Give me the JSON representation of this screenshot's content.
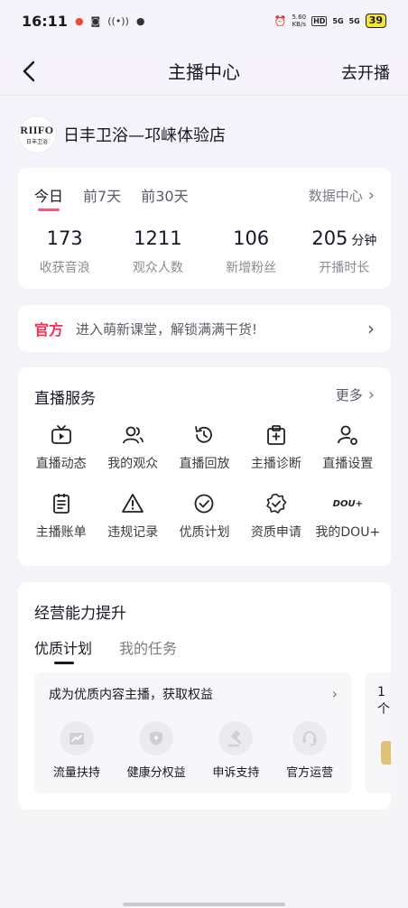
{
  "status_bar": {
    "time": "16:11",
    "net_speed_value": "5.60",
    "net_speed_unit": "KB/s",
    "hd_tag": "HD",
    "sig1": "5G",
    "sig2": "5G",
    "battery": "39"
  },
  "nav": {
    "title": "主播中心",
    "action": "去开播"
  },
  "shop": {
    "logo_line1": "RIIFO",
    "logo_line2": "日丰卫浴",
    "name": "日丰卫浴—邛崃体验店"
  },
  "stats": {
    "tabs": [
      "今日",
      "前7天",
      "前30天"
    ],
    "data_center": "数据中心",
    "metrics": [
      {
        "value": "173",
        "unit": "",
        "label": "收获音浪"
      },
      {
        "value": "1211",
        "unit": "",
        "label": "观众人数"
      },
      {
        "value": "106",
        "unit": "",
        "label": "新增粉丝"
      },
      {
        "value": "205",
        "unit": "分钟",
        "label": "开播时长"
      }
    ]
  },
  "promo": {
    "tag": "官方",
    "text": "进入萌新课堂，解锁满满干货!"
  },
  "services": {
    "title": "直播服务",
    "more": "更多",
    "items": [
      {
        "label": "直播动态",
        "icon": "tv-play-icon"
      },
      {
        "label": "我的观众",
        "icon": "audience-icon"
      },
      {
        "label": "直播回放",
        "icon": "replay-icon"
      },
      {
        "label": "主播诊断",
        "icon": "diagnosis-icon"
      },
      {
        "label": "直播设置",
        "icon": "settings-user-icon"
      },
      {
        "label": "主播账单",
        "icon": "bill-icon"
      },
      {
        "label": "违规记录",
        "icon": "warning-icon"
      },
      {
        "label": "优质计划",
        "icon": "check-circle-icon"
      },
      {
        "label": "资质申请",
        "icon": "badge-check-icon"
      },
      {
        "label": "我的DOU+",
        "icon": "dou-icon",
        "icon_text": "DOU+"
      }
    ]
  },
  "ability": {
    "title": "经营能力提升",
    "tabs": [
      "优质计划",
      "我的任务"
    ],
    "plan_card": {
      "heading": "成为优质内容主播，获取权益",
      "benefits": [
        {
          "label": "流量扶持",
          "icon": "traffic-icon"
        },
        {
          "label": "健康分权益",
          "icon": "shield-icon"
        },
        {
          "label": "申诉支持",
          "icon": "gavel-icon"
        },
        {
          "label": "官方运营",
          "icon": "headset-icon"
        }
      ]
    },
    "next_card_peek": "1个"
  },
  "colors": {
    "accent": "#fe2c55",
    "text": "#161823",
    "muted": "#8a8b91"
  }
}
